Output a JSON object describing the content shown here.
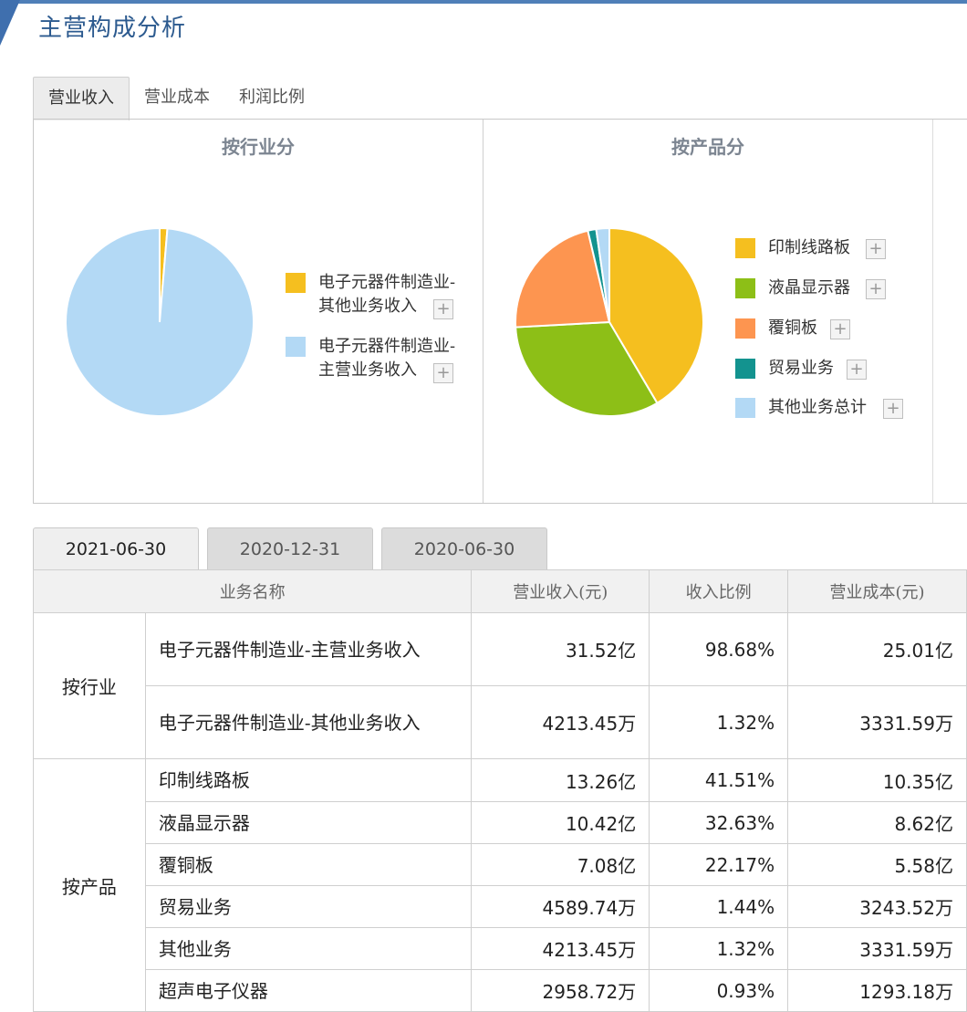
{
  "page": {
    "title": "主营构成分析"
  },
  "main_tabs": [
    {
      "label": "营业收入",
      "active": true
    },
    {
      "label": "营业成本",
      "active": false
    },
    {
      "label": "利润比例",
      "active": false
    }
  ],
  "charts": {
    "industry": {
      "title": "按行业分",
      "legend": [
        {
          "label_line1": "电子元器件制造业-",
          "label_line2": "其他业务收入",
          "color": "#f5bf1f"
        },
        {
          "label_line1": "电子元器件制造业-",
          "label_line2": "主营业务收入",
          "color": "#b3d9f5"
        }
      ]
    },
    "product": {
      "title": "按产品分",
      "legend": [
        {
          "label": "印制线路板",
          "color": "#f5bf1f"
        },
        {
          "label": "液晶显示器",
          "color": "#8dbf17"
        },
        {
          "label": "覆铜板",
          "color": "#fd9550"
        },
        {
          "label": "贸易业务",
          "color": "#13938f"
        },
        {
          "label": "其他业务总计",
          "color": "#b3d9f5"
        }
      ]
    }
  },
  "chart_data": [
    {
      "type": "pie",
      "title": "按行业分",
      "categories": [
        "电子元器件制造业-其他业务收入",
        "电子元器件制造业-主营业务收入"
      ],
      "values": [
        1.32,
        98.68
      ],
      "colors": [
        "#f5bf1f",
        "#b3d9f5"
      ]
    },
    {
      "type": "pie",
      "title": "按产品分",
      "categories": [
        "印制线路板",
        "液晶显示器",
        "覆铜板",
        "贸易业务",
        "其他业务总计"
      ],
      "values": [
        41.51,
        32.63,
        22.17,
        1.44,
        2.25
      ],
      "colors": [
        "#f5bf1f",
        "#8dbf17",
        "#fd9550",
        "#13938f",
        "#b3d9f5"
      ]
    }
  ],
  "date_tabs": [
    {
      "label": "2021-06-30",
      "active": true
    },
    {
      "label": "2020-12-31",
      "active": false
    },
    {
      "label": "2020-06-30",
      "active": false
    }
  ],
  "table": {
    "headers": [
      "业务名称",
      "营业收入(元)",
      "收入比例",
      "营业成本(元)"
    ],
    "groups": [
      {
        "label": "按行业",
        "rows": [
          {
            "name": "电子元器件制造业-主营业务收入",
            "revenue_num": "31.52",
            "revenue_unit": "亿",
            "ratio": "98.68%",
            "cost_num": "25.01",
            "cost_unit": "亿"
          },
          {
            "name": "电子元器件制造业-其他业务收入",
            "revenue_num": "4213.45",
            "revenue_unit": "万",
            "ratio": "1.32%",
            "cost_num": "3331.59",
            "cost_unit": "万"
          }
        ]
      },
      {
        "label": "按产品",
        "rows": [
          {
            "name": "印制线路板",
            "revenue_num": "13.26",
            "revenue_unit": "亿",
            "ratio": "41.51%",
            "cost_num": "10.35",
            "cost_unit": "亿"
          },
          {
            "name": "液晶显示器",
            "revenue_num": "10.42",
            "revenue_unit": "亿",
            "ratio": "32.63%",
            "cost_num": "8.62",
            "cost_unit": "亿"
          },
          {
            "name": "覆铜板",
            "revenue_num": "7.08",
            "revenue_unit": "亿",
            "ratio": "22.17%",
            "cost_num": "5.58",
            "cost_unit": "亿"
          },
          {
            "name": "贸易业务",
            "revenue_num": "4589.74",
            "revenue_unit": "万",
            "ratio": "1.44%",
            "cost_num": "3243.52",
            "cost_unit": "万"
          },
          {
            "name": "其他业务",
            "revenue_num": "4213.45",
            "revenue_unit": "万",
            "ratio": "1.32%",
            "cost_num": "3331.59",
            "cost_unit": "万"
          },
          {
            "name": "超声电子仪器",
            "revenue_num": "2958.72",
            "revenue_unit": "万",
            "ratio": "0.93%",
            "cost_num": "1293.18",
            "cost_unit": "万"
          }
        ]
      }
    ]
  }
}
